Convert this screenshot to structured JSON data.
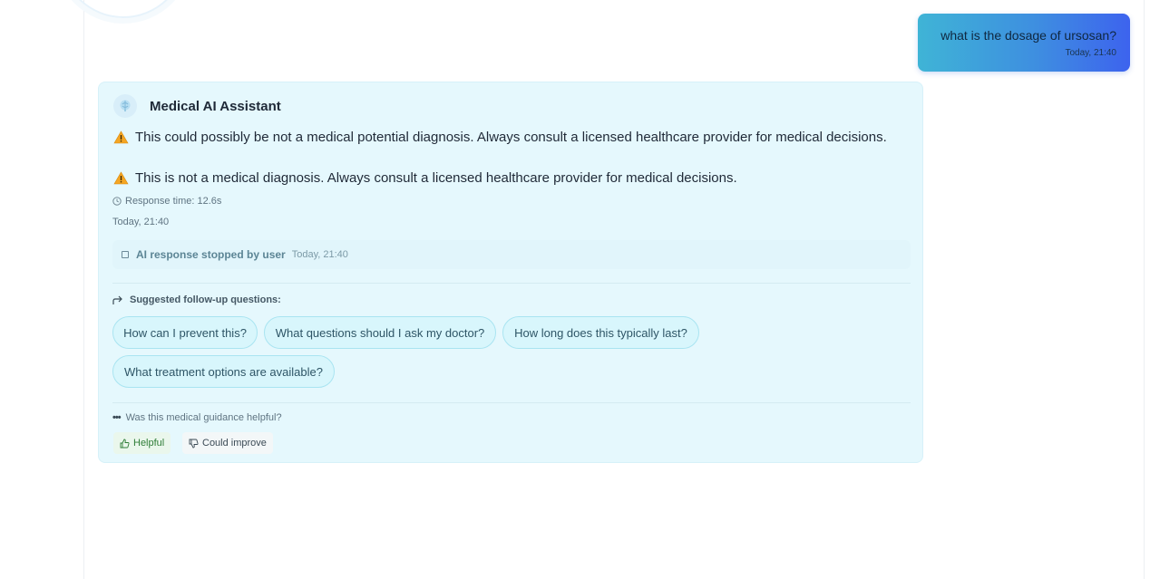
{
  "user_message": {
    "text": "what is the dosage of ursosan?",
    "time": "Today, 21:40"
  },
  "assistant": {
    "name": "Medical AI Assistant",
    "warning_1": "This could possibly be not a medical potential diagnosis. Always consult a licensed healthcare provider for medical decisions.",
    "warning_2": "This is not a medical diagnosis. Always consult a licensed healthcare provider for medical decisions.",
    "response_time": "Response time: 12.6s",
    "time": "Today, 21:40",
    "stopped_label": "AI response stopped by user",
    "stopped_time": "Today, 21:40"
  },
  "followups": {
    "heading": "Suggested follow-up questions:",
    "questions": [
      "How can I prevent this?",
      "What questions should I ask my doctor?",
      "How long does this typically last?",
      "What treatment options are available?"
    ]
  },
  "feedback": {
    "question": "Was this medical guidance helpful?",
    "helpful_label": "Helpful",
    "improve_label": "Could improve"
  },
  "colors": {
    "card_bg": "#e5f8fd",
    "chip_bg": "#d8f6fc",
    "user_gradient_start": "#3fb4d6",
    "user_gradient_end": "#3d63ee",
    "helpful_green": "#2f7d37",
    "warning_amber": "#f5a623"
  },
  "icons": {
    "avatar": "brain-icon",
    "warning": "warning-triangle-icon",
    "clock": "clock-icon",
    "stop": "stop-square-icon",
    "followup": "reply-arrow-icon",
    "helpful": "thumbs-up-icon",
    "improve": "thumbs-down-icon"
  }
}
